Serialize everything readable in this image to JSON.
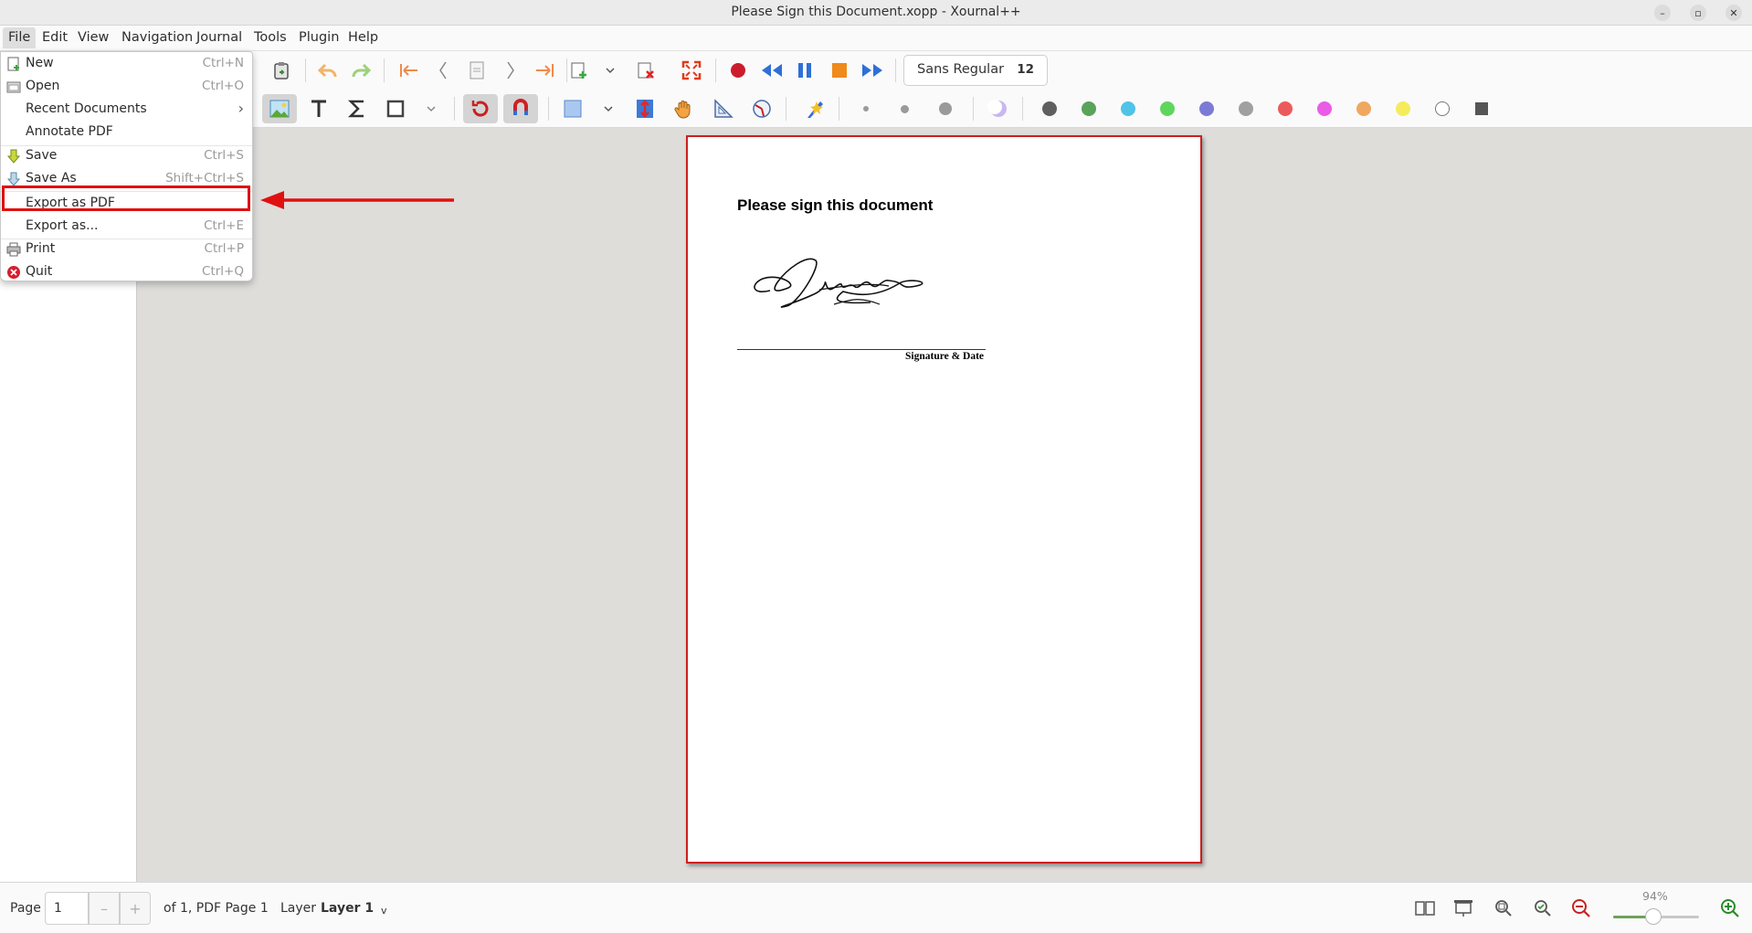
{
  "window": {
    "title": "Please Sign this Document.xopp - Xournal++"
  },
  "menubar": [
    "File",
    "Edit",
    "View",
    "Navigation",
    "Journal",
    "Tools",
    "Plugin",
    "Help"
  ],
  "file_menu": {
    "new": {
      "label": "New",
      "accel": "Ctrl+N"
    },
    "open": {
      "label": "Open",
      "accel": "Ctrl+O"
    },
    "recent": {
      "label": "Recent Documents",
      "accel": "›"
    },
    "annotate": {
      "label": "Annotate PDF",
      "accel": ""
    },
    "save": {
      "label": "Save",
      "accel": "Ctrl+S"
    },
    "save_as": {
      "label": "Save As",
      "accel": "Shift+Ctrl+S"
    },
    "export_pdf": {
      "label": "Export as PDF",
      "accel": ""
    },
    "export_as": {
      "label": "Export as...",
      "accel": "Ctrl+E"
    },
    "print": {
      "label": "Print",
      "accel": "Ctrl+P"
    },
    "quit": {
      "label": "Quit",
      "accel": "Ctrl+Q"
    }
  },
  "toolbar": {
    "font_name": "Sans Regular",
    "font_size": "12"
  },
  "colors": {
    "accent_red": "#e01010",
    "palette": [
      "#5f5f5f",
      "#5aa35a",
      "#4fc3e8",
      "#5ed65e",
      "#7b7bd6",
      "#a0a0a0",
      "#ec5b5b",
      "#ea5be6",
      "#f0a860",
      "#f4ec5c",
      "#ffffff"
    ]
  },
  "document": {
    "heading": "Please sign this document",
    "signature_caption": "Signature & Date"
  },
  "status": {
    "page_label": "Page",
    "page_value": "1",
    "page_of": "of 1, PDF Page 1",
    "layer_label": "Layer",
    "layer_value": "Layer 1",
    "zoom_text": "94%",
    "zoom_fraction": 0.47
  }
}
